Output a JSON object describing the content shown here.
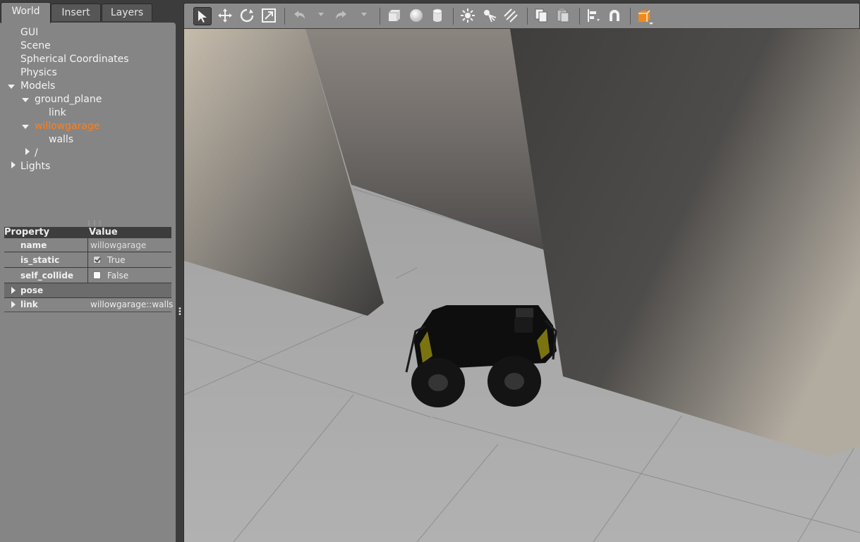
{
  "tabs": [
    {
      "label": "World",
      "active": true
    },
    {
      "label": "Insert",
      "active": false
    },
    {
      "label": "Layers",
      "active": false
    }
  ],
  "tree": {
    "gui": "GUI",
    "scene": "Scene",
    "spherical": "Spherical Coordinates",
    "physics": "Physics",
    "models": "Models",
    "ground_plane": "ground_plane",
    "ground_link": "link",
    "willowgarage": "willowgarage",
    "walls": "walls",
    "slash": "/",
    "lights": "Lights"
  },
  "properties": {
    "header": {
      "property": "Property",
      "value": "Value"
    },
    "name": {
      "key": "name",
      "value": "willowgarage"
    },
    "is_static": {
      "key": "is_static",
      "value": "True",
      "checked": true
    },
    "self_collide": {
      "key": "self_collide",
      "value": "False",
      "checked": false
    },
    "pose": {
      "key": "pose"
    },
    "link": {
      "key": "link",
      "value": "willowgarage::walls"
    }
  },
  "colors": {
    "selected": "#ff7f1c",
    "panel": "#858585",
    "background": "#3c3c3c"
  },
  "toolbar": {
    "icons": [
      "select-mode-icon",
      "translate-mode-icon",
      "rotate-mode-icon",
      "scale-mode-icon",
      "undo-icon",
      "redo-icon",
      "box-icon",
      "sphere-icon",
      "cylinder-icon",
      "point-light-icon",
      "spot-light-icon",
      "directional-light-icon",
      "copy-icon",
      "paste-icon",
      "align-icon",
      "snap-icon",
      "view-angle-icon"
    ]
  }
}
